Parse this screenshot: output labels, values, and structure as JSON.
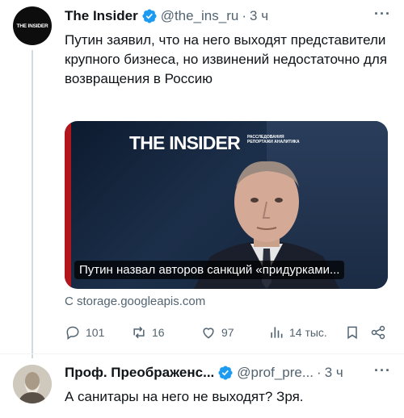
{
  "tweet": {
    "avatar_text": "THE INSIDER",
    "author_name": "The Insider",
    "handle": "@the_ins_ru",
    "separator": "·",
    "time": "3 ч",
    "more": "···",
    "text": "Путин заявил, что на него выходят представители крупного бизнеса, но извинений недостаточно для возвращения в Россию",
    "card": {
      "brand": "THE INSIDER",
      "brand_sub": "РАССЛЕДОВАНИЯ РЕПОРТАЖИ АНАЛИТИКА",
      "caption": "Путин назвал авторов санкций «придурками...",
      "source": "С storage.googleapis.com"
    },
    "actions": {
      "replies": "101",
      "retweets": "16",
      "likes": "97",
      "views": "14 тыс."
    }
  },
  "reply": {
    "author_name": "Проф. Преображенс...",
    "handle": "@prof_pre...",
    "separator": "·",
    "time": "3 ч",
    "more": "···",
    "text": "А санитары на него не выходят? Зря."
  },
  "colors": {
    "verified": "#1d9bf0",
    "muted": "#536471",
    "text": "#0f1419",
    "card_accent": "#b3151c"
  },
  "icons": [
    "verified-badge-icon",
    "reply-icon",
    "retweet-icon",
    "like-icon",
    "views-icon",
    "bookmark-icon",
    "share-icon",
    "more-icon"
  ]
}
